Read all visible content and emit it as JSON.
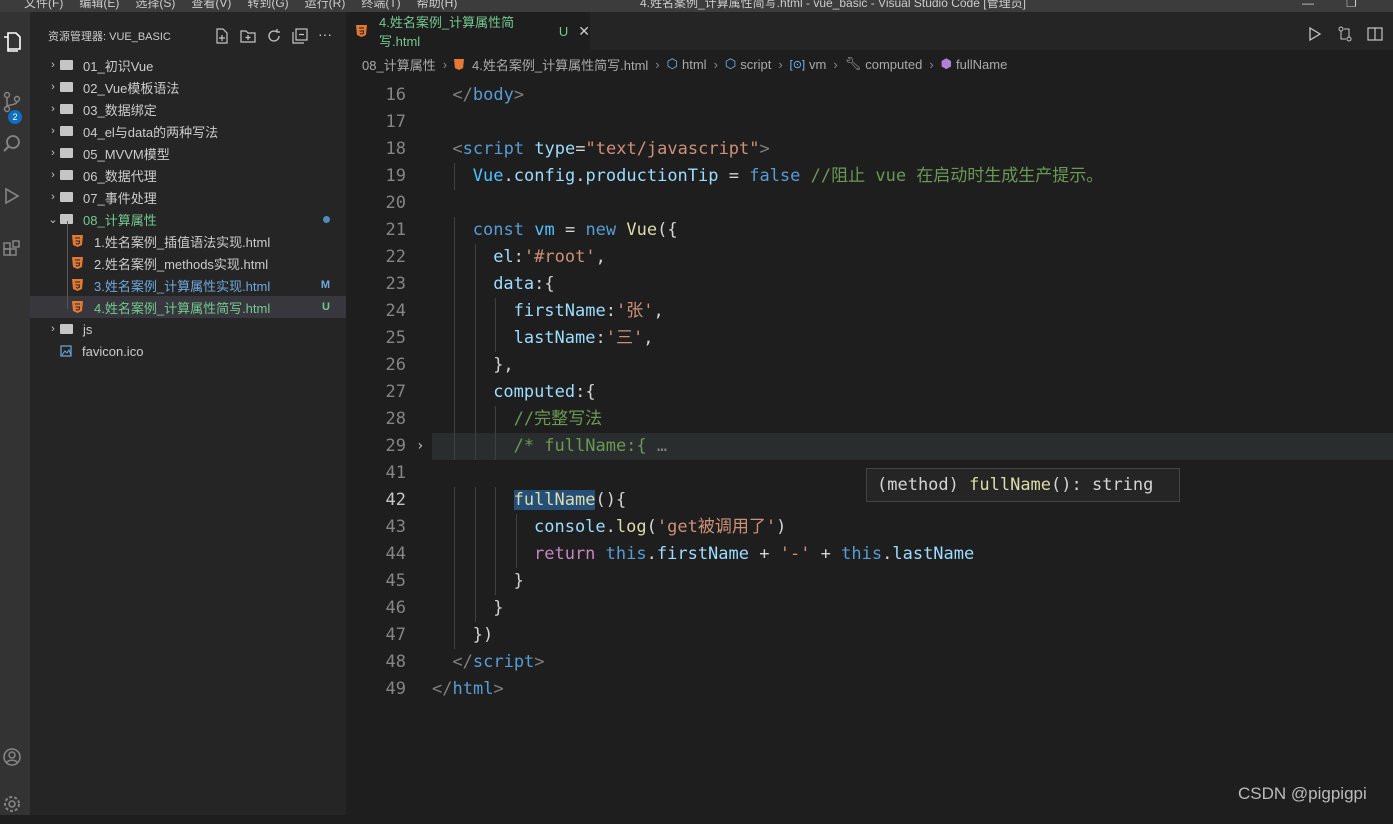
{
  "titlebar": {
    "menu": [
      "文件(F)",
      "编辑(E)",
      "选择(S)",
      "查看(V)",
      "转到(G)",
      "运行(R)",
      "终端(T)",
      "帮助(H)"
    ],
    "title": "4.姓名案例_计算属性简写.html - vue_basic - Visual Studio Code [管理员]"
  },
  "activity": {
    "scm_badge": "2"
  },
  "explorer": {
    "header": "资源管理器: VUE_BASIC",
    "items": [
      {
        "label": "01_初识Vue"
      },
      {
        "label": "02_Vue模板语法"
      },
      {
        "label": "03_数据绑定"
      },
      {
        "label": "04_el与data的两种写法"
      },
      {
        "label": "05_MVVM模型"
      },
      {
        "label": "06_数据代理"
      },
      {
        "label": "07_事件处理"
      },
      {
        "label": "08_计算属性"
      },
      {
        "label": "1.姓名案例_插值语法实现.html"
      },
      {
        "label": "2.姓名案例_methods实现.html"
      },
      {
        "label": "3.姓名案例_计算属性实现.html",
        "status": "M"
      },
      {
        "label": "4.姓名案例_计算属性简写.html",
        "status": "U"
      },
      {
        "label": "js"
      },
      {
        "label": "favicon.ico"
      }
    ]
  },
  "tab": {
    "label": "4.姓名案例_计算属性简写.html",
    "status": "U"
  },
  "breadcrumb": [
    "08_计算属性",
    "4.姓名案例_计算属性简写.html",
    "html",
    "script",
    "vm",
    "computed",
    "fullName"
  ],
  "code": {
    "line_numbers": [
      "16",
      "17",
      "18",
      "19",
      "20",
      "21",
      "22",
      "23",
      "24",
      "25",
      "26",
      "27",
      "28",
      "29",
      "41",
      "42",
      "43",
      "44",
      "45",
      "46",
      "47",
      "48",
      "49"
    ],
    "current_line": "42",
    "lines": [
      [
        [
          "</",
          "p"
        ],
        [
          "body",
          "t"
        ],
        [
          ">",
          "p"
        ]
      ],
      [],
      [
        [
          "<",
          "p"
        ],
        [
          "script",
          "t"
        ],
        [
          " ",
          "w"
        ],
        [
          "type",
          "a"
        ],
        [
          "=",
          "w"
        ],
        [
          "\"text/javascript\"",
          "s"
        ],
        [
          ">",
          "p"
        ]
      ],
      [
        [
          "Vue",
          "v"
        ],
        [
          ".",
          "w"
        ],
        [
          "config",
          "a"
        ],
        [
          ".",
          "w"
        ],
        [
          "productionTip",
          "a"
        ],
        [
          " = ",
          "w"
        ],
        [
          "false",
          "k"
        ],
        [
          " //阻止 vue 在启动时生成生产提示。",
          "c"
        ]
      ],
      [],
      [
        [
          "const",
          "k"
        ],
        [
          " ",
          "w"
        ],
        [
          "vm",
          "v"
        ],
        [
          " = ",
          "w"
        ],
        [
          "new",
          "k"
        ],
        [
          " ",
          "w"
        ],
        [
          "Vue",
          "f"
        ],
        [
          "({",
          "w"
        ]
      ],
      [
        [
          "el",
          "a"
        ],
        [
          ":",
          "w"
        ],
        [
          "'#root'",
          "s"
        ],
        [
          ",",
          "w"
        ]
      ],
      [
        [
          "data",
          "a"
        ],
        [
          ":{",
          "w"
        ]
      ],
      [
        [
          "firstName",
          "a"
        ],
        [
          ":",
          "w"
        ],
        [
          "'张'",
          "s"
        ],
        [
          ",",
          "w"
        ]
      ],
      [
        [
          "lastName",
          "a"
        ],
        [
          ":",
          "w"
        ],
        [
          "'三'",
          "s"
        ],
        [
          ",",
          "w"
        ]
      ],
      [
        [
          "},",
          "w"
        ]
      ],
      [
        [
          "computed",
          "a"
        ],
        [
          ":{",
          "w"
        ]
      ],
      [
        [
          "//完整写法",
          "c"
        ]
      ],
      [
        [
          "/* fullName:{",
          "c"
        ],
        [
          " …",
          "p"
        ]
      ],
      [],
      [
        [
          "fullName",
          "hl"
        ],
        [
          "(){",
          "w"
        ]
      ],
      [
        [
          "console",
          "a"
        ],
        [
          ".",
          "w"
        ],
        [
          "log",
          "f"
        ],
        [
          "(",
          "w"
        ],
        [
          "'get被调用了'",
          "s"
        ],
        [
          ")",
          "w"
        ]
      ],
      [
        [
          "return",
          "kw"
        ],
        [
          " ",
          "w"
        ],
        [
          "this",
          "k"
        ],
        [
          ".",
          "w"
        ],
        [
          "firstName",
          "a"
        ],
        [
          " + ",
          "w"
        ],
        [
          "'-'",
          "s"
        ],
        [
          " + ",
          "w"
        ],
        [
          "this",
          "k"
        ],
        [
          ".",
          "w"
        ],
        [
          "lastName",
          "a"
        ]
      ],
      [
        [
          "}",
          "w"
        ]
      ],
      [
        [
          "}",
          "w"
        ]
      ],
      [
        [
          "})",
          "w"
        ]
      ],
      [
        [
          "</",
          "p"
        ],
        [
          "script",
          "t"
        ],
        [
          ">",
          "p"
        ]
      ],
      [
        [
          "</",
          "p"
        ],
        [
          "html",
          "t"
        ],
        [
          ">",
          "p"
        ]
      ]
    ]
  },
  "hover": {
    "kind": "(method)",
    "name": "fullName",
    "sig": "(): string"
  },
  "watermark": "CSDN @pigpigpi"
}
